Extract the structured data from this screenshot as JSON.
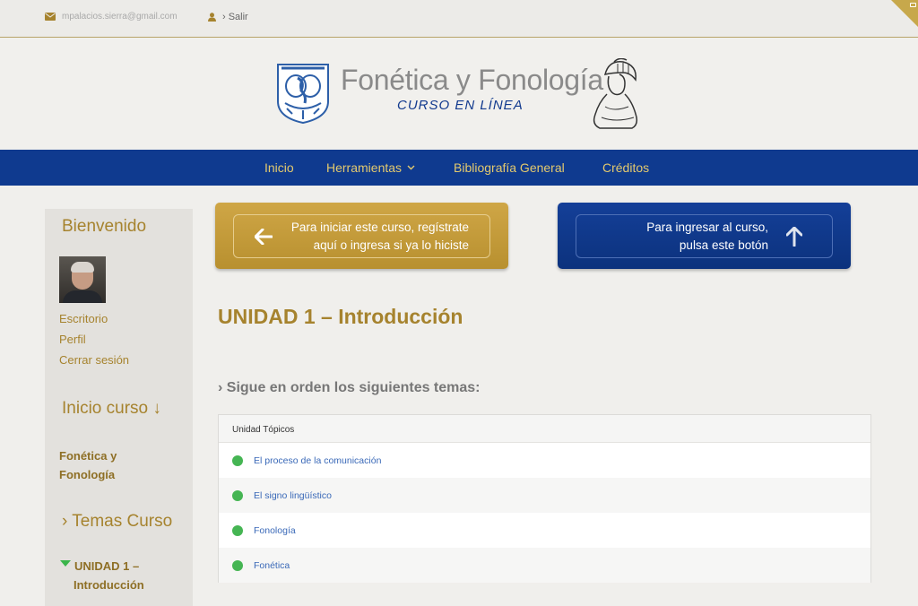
{
  "topbar": {
    "email": "mpalacios.sierra@gmail.com",
    "logout": "› Salir"
  },
  "header": {
    "title": "Fonética y Fonología",
    "subtitle": "CURSO EN LÍNEA"
  },
  "nav": {
    "items": [
      {
        "label": "Inicio"
      },
      {
        "label": "Herramientas",
        "has_dropdown": true
      },
      {
        "label": "Bibliografía General"
      },
      {
        "label": "Créditos"
      }
    ]
  },
  "sidebar": {
    "welcome": "Bienvenido",
    "links": [
      "Escritorio",
      "Perfil",
      "Cerrar sesión"
    ],
    "course_start": "Inicio curso ↓",
    "course_name": [
      "Fonética y",
      "Fonología"
    ],
    "topics_heading": "› Temas Curso",
    "current_unit": [
      "UNIDAD 1 –",
      "Introducción"
    ]
  },
  "cta": {
    "register": [
      "Para iniciar este curso, regístrate",
      "aquí o ingresa si ya lo hiciste"
    ],
    "enter": [
      "Para ingresar al curso,",
      "pulsa este botón"
    ]
  },
  "main": {
    "unit_title": "UNIDAD 1 – Introducción",
    "follow_text": "› Sigue en orden los siguientes temas:",
    "table_header": "Unidad Tópicos",
    "topics": [
      "El proceso de la comunicación",
      "El signo lingüístico",
      "Fonología",
      "Fonética"
    ]
  },
  "colors": {
    "gold": "#a6832e",
    "navy": "#0f3a8f",
    "nav_text": "#e3c96e",
    "status_green": "#45b553"
  }
}
